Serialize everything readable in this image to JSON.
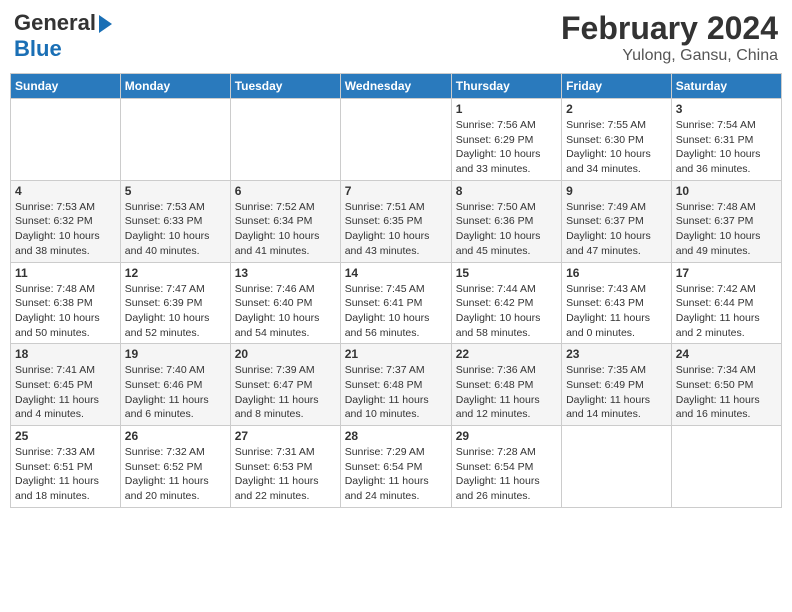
{
  "logo": {
    "line1": "General",
    "line2": "Blue"
  },
  "title": "February 2024",
  "subtitle": "Yulong, Gansu, China",
  "weekdays": [
    "Sunday",
    "Monday",
    "Tuesday",
    "Wednesday",
    "Thursday",
    "Friday",
    "Saturday"
  ],
  "weeks": [
    [
      {
        "day": "",
        "info": ""
      },
      {
        "day": "",
        "info": ""
      },
      {
        "day": "",
        "info": ""
      },
      {
        "day": "",
        "info": ""
      },
      {
        "day": "1",
        "info": "Sunrise: 7:56 AM\nSunset: 6:29 PM\nDaylight: 10 hours\nand 33 minutes."
      },
      {
        "day": "2",
        "info": "Sunrise: 7:55 AM\nSunset: 6:30 PM\nDaylight: 10 hours\nand 34 minutes."
      },
      {
        "day": "3",
        "info": "Sunrise: 7:54 AM\nSunset: 6:31 PM\nDaylight: 10 hours\nand 36 minutes."
      }
    ],
    [
      {
        "day": "4",
        "info": "Sunrise: 7:53 AM\nSunset: 6:32 PM\nDaylight: 10 hours\nand 38 minutes."
      },
      {
        "day": "5",
        "info": "Sunrise: 7:53 AM\nSunset: 6:33 PM\nDaylight: 10 hours\nand 40 minutes."
      },
      {
        "day": "6",
        "info": "Sunrise: 7:52 AM\nSunset: 6:34 PM\nDaylight: 10 hours\nand 41 minutes."
      },
      {
        "day": "7",
        "info": "Sunrise: 7:51 AM\nSunset: 6:35 PM\nDaylight: 10 hours\nand 43 minutes."
      },
      {
        "day": "8",
        "info": "Sunrise: 7:50 AM\nSunset: 6:36 PM\nDaylight: 10 hours\nand 45 minutes."
      },
      {
        "day": "9",
        "info": "Sunrise: 7:49 AM\nSunset: 6:37 PM\nDaylight: 10 hours\nand 47 minutes."
      },
      {
        "day": "10",
        "info": "Sunrise: 7:48 AM\nSunset: 6:37 PM\nDaylight: 10 hours\nand 49 minutes."
      }
    ],
    [
      {
        "day": "11",
        "info": "Sunrise: 7:48 AM\nSunset: 6:38 PM\nDaylight: 10 hours\nand 50 minutes."
      },
      {
        "day": "12",
        "info": "Sunrise: 7:47 AM\nSunset: 6:39 PM\nDaylight: 10 hours\nand 52 minutes."
      },
      {
        "day": "13",
        "info": "Sunrise: 7:46 AM\nSunset: 6:40 PM\nDaylight: 10 hours\nand 54 minutes."
      },
      {
        "day": "14",
        "info": "Sunrise: 7:45 AM\nSunset: 6:41 PM\nDaylight: 10 hours\nand 56 minutes."
      },
      {
        "day": "15",
        "info": "Sunrise: 7:44 AM\nSunset: 6:42 PM\nDaylight: 10 hours\nand 58 minutes."
      },
      {
        "day": "16",
        "info": "Sunrise: 7:43 AM\nSunset: 6:43 PM\nDaylight: 11 hours\nand 0 minutes."
      },
      {
        "day": "17",
        "info": "Sunrise: 7:42 AM\nSunset: 6:44 PM\nDaylight: 11 hours\nand 2 minutes."
      }
    ],
    [
      {
        "day": "18",
        "info": "Sunrise: 7:41 AM\nSunset: 6:45 PM\nDaylight: 11 hours\nand 4 minutes."
      },
      {
        "day": "19",
        "info": "Sunrise: 7:40 AM\nSunset: 6:46 PM\nDaylight: 11 hours\nand 6 minutes."
      },
      {
        "day": "20",
        "info": "Sunrise: 7:39 AM\nSunset: 6:47 PM\nDaylight: 11 hours\nand 8 minutes."
      },
      {
        "day": "21",
        "info": "Sunrise: 7:37 AM\nSunset: 6:48 PM\nDaylight: 11 hours\nand 10 minutes."
      },
      {
        "day": "22",
        "info": "Sunrise: 7:36 AM\nSunset: 6:48 PM\nDaylight: 11 hours\nand 12 minutes."
      },
      {
        "day": "23",
        "info": "Sunrise: 7:35 AM\nSunset: 6:49 PM\nDaylight: 11 hours\nand 14 minutes."
      },
      {
        "day": "24",
        "info": "Sunrise: 7:34 AM\nSunset: 6:50 PM\nDaylight: 11 hours\nand 16 minutes."
      }
    ],
    [
      {
        "day": "25",
        "info": "Sunrise: 7:33 AM\nSunset: 6:51 PM\nDaylight: 11 hours\nand 18 minutes."
      },
      {
        "day": "26",
        "info": "Sunrise: 7:32 AM\nSunset: 6:52 PM\nDaylight: 11 hours\nand 20 minutes."
      },
      {
        "day": "27",
        "info": "Sunrise: 7:31 AM\nSunset: 6:53 PM\nDaylight: 11 hours\nand 22 minutes."
      },
      {
        "day": "28",
        "info": "Sunrise: 7:29 AM\nSunset: 6:54 PM\nDaylight: 11 hours\nand 24 minutes."
      },
      {
        "day": "29",
        "info": "Sunrise: 7:28 AM\nSunset: 6:54 PM\nDaylight: 11 hours\nand 26 minutes."
      },
      {
        "day": "",
        "info": ""
      },
      {
        "day": "",
        "info": ""
      }
    ]
  ]
}
